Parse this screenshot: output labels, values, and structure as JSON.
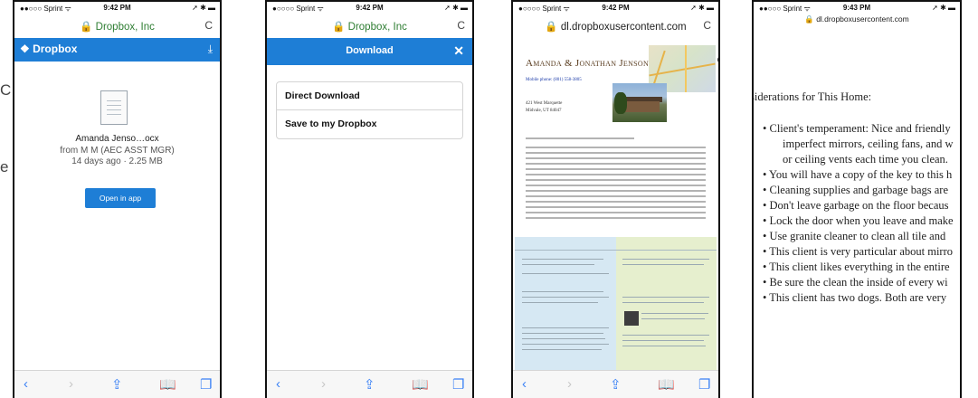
{
  "outside_text": {
    "line1": "C",
    "line2": "e"
  },
  "phones": [
    {
      "status": {
        "carrier": "●●○○○ Sprint ᯤ",
        "time": "9:42 PM",
        "battery": "➚ ✱ ▬"
      },
      "url": "🔒 Dropbox, Inc",
      "reload_icon": "C",
      "header": {
        "logo": "Dropbox",
        "download_icon": "⤓"
      },
      "file": {
        "name": "Amanda Jenso…ocx",
        "from": "from M M (AEC ASST MGR)",
        "age": "14 days ago · 2.25 MB"
      },
      "open_button": "Open in app"
    },
    {
      "status": {
        "carrier": "●○○○○ Sprint ᯤ",
        "time": "9:42 PM",
        "battery": "➚ ✱ ▬"
      },
      "url": "🔒 Dropbox, Inc",
      "reload_icon": "C",
      "header_title": "Download",
      "close_icon": "✕",
      "menu": [
        "Direct Download",
        "Save to my Dropbox"
      ]
    },
    {
      "status": {
        "carrier": "●○○○○ Sprint ᯤ",
        "time": "9:42 PM",
        "battery": "➚ ✱ ▬"
      },
      "url": "🔒 dl.dropboxusercontent.com",
      "reload_icon": "C",
      "doc": {
        "name": "Amanda & Jonathan Jenson",
        "phone": "Mobile phone: (801) 558-3805",
        "address1": "421 West Marquette",
        "address2": "Midvale, UT 84047"
      }
    },
    {
      "status": {
        "carrier": "●●○○○ Sprint ᯤ",
        "time": "9:43 PM",
        "battery": "➚ ✱ ▬"
      },
      "url": "🔒 dl.dropboxusercontent.com",
      "doc_lines": [
        "siderations for This Home:",
        "• Client's temperament: Nice and friendly",
        "imperfect mirrors, ceiling fans, and w",
        "or ceiling vents each time you clean.",
        "• You will have a copy of the key to this h",
        "• Cleaning supplies and garbage bags are",
        "• Don't leave garbage on the floor becaus",
        "• Lock the door when you leave and make",
        "• Use granite cleaner to clean all tile and",
        "• This client is very particular about mirro",
        "• This client likes everything in the entire",
        "• Be sure the clean the inside of every wi",
        "• This client has two dogs. Both are very"
      ]
    }
  ],
  "toolbar": {
    "back": "‹",
    "forward": "›",
    "share": "⇪",
    "bookmarks": "📖",
    "tabs": "❐"
  }
}
